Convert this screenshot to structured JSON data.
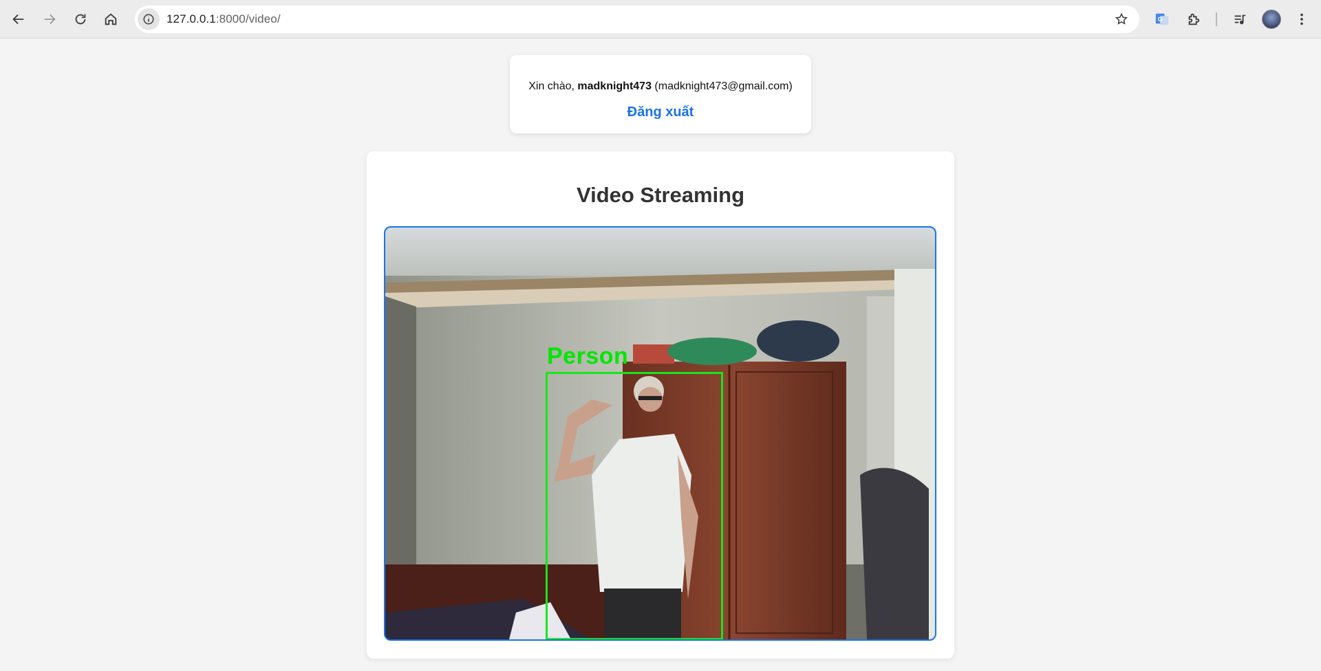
{
  "browser": {
    "url_host": "127.0.0.1",
    "url_path": ":8000/video/",
    "buttons": {
      "back": "back-arrow-icon",
      "forward": "forward-arrow-icon",
      "reload": "reload-icon",
      "home": "home-icon",
      "site_info": "info-icon",
      "bookmark": "star-icon",
      "translate": "google-translate-icon",
      "extensions": "puzzle-icon",
      "media": "media-queue-icon",
      "menu": "kebab-menu-icon"
    }
  },
  "user_card": {
    "greeting_prefix": "Xin chào, ",
    "username": "madknight473",
    "email_text": " (madknight473@gmail.com)",
    "logout_label": "Đăng xuất"
  },
  "stream": {
    "title": "Video Streaming",
    "detection_label": "Person",
    "detection_color": "#19e619",
    "frame_border_color": "#1a73e8"
  }
}
